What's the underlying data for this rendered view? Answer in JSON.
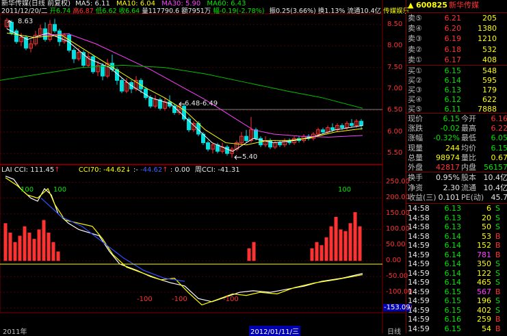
{
  "header": {
    "stock_name": "新华传媒(日线 前复权)",
    "ma5": "MA5: 6.11",
    "ma10": "MA10: 6.04",
    "ma30": "MA30: 5.90",
    "ma60": "MA60: 6.43",
    "date": "2011/12/20/二",
    "open": "开6.74",
    "high": "高6.87",
    "low": "低6.62",
    "close": "收6.64",
    "volume": "量117790.6",
    "amount": "额7951万",
    "change": "幅-0.19(-2.78%)",
    "amplitude": "振0.25(3.66%)",
    "turnover": "换1.13%",
    "float_mkt": "流通10.4亿",
    "sector": "传媒娱乐"
  },
  "price_axis": [
    "8.50",
    "8.00",
    "7.50",
    "7.00",
    "6.50",
    "6.00",
    "5.50"
  ],
  "price_annotations": {
    "high_mark": "8.63",
    "mid_mark": "6.48-6.49",
    "low_mark": "5.40"
  },
  "indicator": {
    "lai_cci": "LAI CCI: 111.45",
    "cci70": "CCI70: -44.62",
    "x": ":-",
    "y": "-44.62",
    "z": ": 0.00",
    "week_cci": "周CCI: -41.31",
    "axis": [
      "250.00",
      "200.00",
      "150.00",
      "100.00",
      "50.00",
      "0.00",
      "-50.00",
      "-100.00",
      "-150.00"
    ],
    "labels": {
      "p100_left": "100",
      "p100_mid": "100",
      "p100_right": "100",
      "m100_a": "-100",
      "m100_b": "-100",
      "m100_c": "-100"
    },
    "current_value": "-153.09"
  },
  "bottom_dates": {
    "d1": "2011年",
    "d2": "2012/01/11/三",
    "d3": "日线"
  },
  "stock_code": "600825",
  "stock_title": "新华传媒",
  "asks": [
    {
      "label": "卖⑤",
      "price": "6.21",
      "vol": "205"
    },
    {
      "label": "卖④",
      "price": "6.20",
      "vol": "1380"
    },
    {
      "label": "卖③",
      "price": "6.19",
      "vol": "1210"
    },
    {
      "label": "卖②",
      "price": "6.18",
      "vol": "532"
    },
    {
      "label": "卖①",
      "price": "6.17",
      "vol": "408"
    }
  ],
  "bids": [
    {
      "label": "买①",
      "price": "6.15",
      "vol": "548"
    },
    {
      "label": "买②",
      "price": "6.14",
      "vol": "595"
    },
    {
      "label": "买③",
      "price": "6.13",
      "vol": "179"
    },
    {
      "label": "买④",
      "price": "6.12",
      "vol": "622"
    },
    {
      "label": "买⑤",
      "price": "6.11",
      "vol": "7888"
    }
  ],
  "stats": [
    {
      "l1": "现价",
      "v1": "6.15",
      "l2": "今开",
      "v2": "6.16",
      "c1": "green",
      "c2": "red"
    },
    {
      "l1": "涨跌",
      "v1": "-0.02",
      "l2": "最高",
      "v2": "6.22",
      "c1": "green",
      "c2": "red"
    },
    {
      "l1": "涨幅",
      "v1": "-0.32%",
      "l2": "最低",
      "v2": "6.05",
      "c1": "green",
      "c2": "green"
    },
    {
      "l1": "现量",
      "v1": "244",
      "l2": "均价",
      "v2": "6.15",
      "c1": "yellow",
      "c2": "green"
    },
    {
      "l1": "总量",
      "v1": "98974",
      "l2": "量比",
      "v2": "0.67",
      "c1": "yellow",
      "c2": "yellow"
    },
    {
      "l1": "外盘",
      "v1": "42817",
      "l2": "内盘",
      "v2": "56157",
      "c1": "red",
      "c2": "green"
    }
  ],
  "fund": [
    {
      "l1": "换手",
      "v1": "0.95%",
      "l2": "股本",
      "v2": "10.4亿"
    },
    {
      "l1": "净资",
      "v1": "2.30",
      "l2": "流通",
      "v2": "10.4亿"
    },
    {
      "l1": "收益(三)",
      "v1": "0.101",
      "l2": "PE(动)",
      "v2": "45.7"
    }
  ],
  "ticks": [
    {
      "t": "14:58",
      "p": "6.13",
      "v": "6",
      "s": "S"
    },
    {
      "t": "14:58",
      "p": "6.13",
      "v": "20",
      "s": "S"
    },
    {
      "t": "14:58",
      "p": "6.13",
      "v": "50",
      "s": "S"
    },
    {
      "t": "14:58",
      "p": "6.14",
      "v": "53",
      "s": "B"
    },
    {
      "t": "14:59",
      "p": "6.14",
      "v": "152",
      "s": "B"
    },
    {
      "t": "14:59",
      "p": "6.14",
      "v": "781",
      "s": "B"
    },
    {
      "t": "14:59",
      "p": "6.14",
      "v": "350",
      "s": "S"
    },
    {
      "t": "14:59",
      "p": "6.14",
      "v": "122",
      "s": "S"
    },
    {
      "t": "14:59",
      "p": "6.14",
      "v": "465",
      "s": "S"
    },
    {
      "t": "14:59",
      "p": "6.15",
      "v": "567",
      "s": "B"
    },
    {
      "t": "14:59",
      "p": "6.15",
      "v": "196",
      "s": "S"
    },
    {
      "t": "14:59",
      "p": "6.15",
      "v": "402",
      "s": "S"
    },
    {
      "t": "14:59",
      "p": "6.16",
      "v": "259",
      "s": "B"
    },
    {
      "t": "14:59",
      "p": "6.15",
      "v": "54",
      "s": "B"
    }
  ],
  "colors": {
    "up": "#ff3232",
    "down": "#00e0e0",
    "ma5": "#ffffff",
    "ma10": "#ffff00",
    "ma30": "#ff40ff",
    "ma60": "#00c000",
    "border": "#800000"
  }
}
